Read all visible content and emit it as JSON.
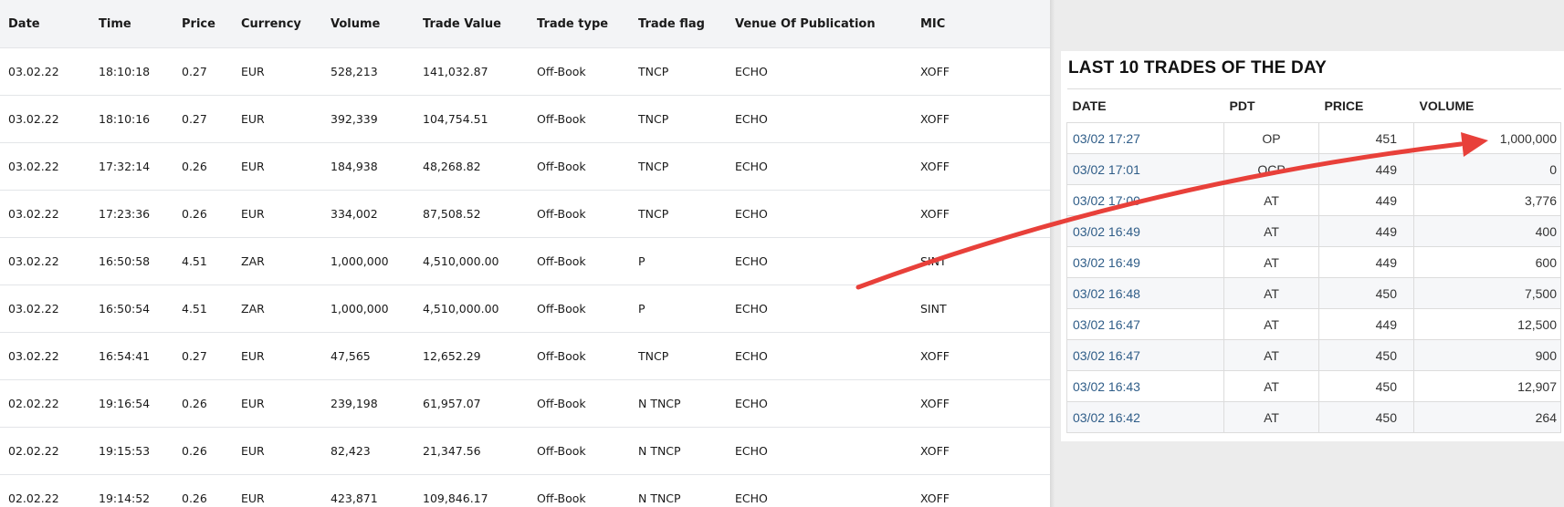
{
  "left_table": {
    "headers": [
      "Date",
      "Time",
      "Price",
      "Currency",
      "Volume",
      "Trade Value",
      "Trade type",
      "Trade flag",
      "Venue Of Publication",
      "MIC"
    ],
    "rows": [
      [
        "03.02.22",
        "18:10:18",
        "0.27",
        "EUR",
        "528,213",
        "141,032.87",
        "Off-Book",
        "TNCP",
        "ECHO",
        "XOFF"
      ],
      [
        "03.02.22",
        "18:10:16",
        "0.27",
        "EUR",
        "392,339",
        "104,754.51",
        "Off-Book",
        "TNCP",
        "ECHO",
        "XOFF"
      ],
      [
        "03.02.22",
        "17:32:14",
        "0.26",
        "EUR",
        "184,938",
        "48,268.82",
        "Off-Book",
        "TNCP",
        "ECHO",
        "XOFF"
      ],
      [
        "03.02.22",
        "17:23:36",
        "0.26",
        "EUR",
        "334,002",
        "87,508.52",
        "Off-Book",
        "TNCP",
        "ECHO",
        "XOFF"
      ],
      [
        "03.02.22",
        "16:50:58",
        "4.51",
        "ZAR",
        "1,000,000",
        "4,510,000.00",
        "Off-Book",
        "P",
        "ECHO",
        "SINT"
      ],
      [
        "03.02.22",
        "16:50:54",
        "4.51",
        "ZAR",
        "1,000,000",
        "4,510,000.00",
        "Off-Book",
        "P",
        "ECHO",
        "SINT"
      ],
      [
        "03.02.22",
        "16:54:41",
        "0.27",
        "EUR",
        "47,565",
        "12,652.29",
        "Off-Book",
        "TNCP",
        "ECHO",
        "XOFF"
      ],
      [
        "02.02.22",
        "19:16:54",
        "0.26",
        "EUR",
        "239,198",
        "61,957.07",
        "Off-Book",
        "N TNCP",
        "ECHO",
        "XOFF"
      ],
      [
        "02.02.22",
        "19:15:53",
        "0.26",
        "EUR",
        "82,423",
        "21,347.56",
        "Off-Book",
        "N TNCP",
        "ECHO",
        "XOFF"
      ],
      [
        "02.02.22",
        "19:14:52",
        "0.26",
        "EUR",
        "423,871",
        "109,846.17",
        "Off-Book",
        "N TNCP",
        "ECHO",
        "XOFF"
      ]
    ]
  },
  "last_trades": {
    "title": "LAST 10 TRADES OF THE DAY",
    "headers": [
      "DATE",
      "PDT",
      "PRICE",
      "VOLUME"
    ],
    "rows": [
      [
        "03/02 17:27",
        "OP",
        "451",
        "1,000,000"
      ],
      [
        "03/02 17:01",
        "OCP",
        "449",
        "0"
      ],
      [
        "03/02 17:00",
        "AT",
        "449",
        "3,776"
      ],
      [
        "03/02 16:49",
        "AT",
        "449",
        "400"
      ],
      [
        "03/02 16:49",
        "AT",
        "449",
        "600"
      ],
      [
        "03/02 16:48",
        "AT",
        "450",
        "7,500"
      ],
      [
        "03/02 16:47",
        "AT",
        "449",
        "12,500"
      ],
      [
        "03/02 16:47",
        "AT",
        "450",
        "900"
      ],
      [
        "03/02 16:43",
        "AT",
        "450",
        "12,907"
      ],
      [
        "03/02 16:42",
        "AT",
        "450",
        "264"
      ]
    ]
  },
  "annotation": {
    "arrow_color": "#e8403a"
  }
}
